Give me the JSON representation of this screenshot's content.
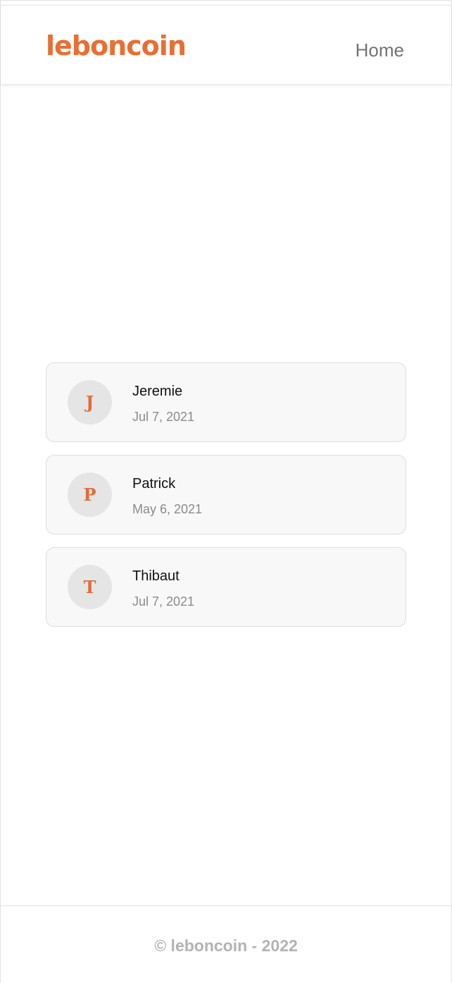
{
  "header": {
    "logo_text": "leboncoin",
    "nav_home_label": "Home"
  },
  "conversations": [
    {
      "initial": "J",
      "name": "Jeremie",
      "date": "Jul 7, 2021"
    },
    {
      "initial": "P",
      "name": "Patrick",
      "date": "May 6, 2021"
    },
    {
      "initial": "T",
      "name": "Thibaut",
      "date": "Jul 7, 2021"
    }
  ],
  "footer": {
    "copyright": "© leboncoin - 2022"
  },
  "colors": {
    "brand": "#ea6e32",
    "card_background": "#f8f8f8",
    "avatar_background": "#e5e5e5"
  }
}
